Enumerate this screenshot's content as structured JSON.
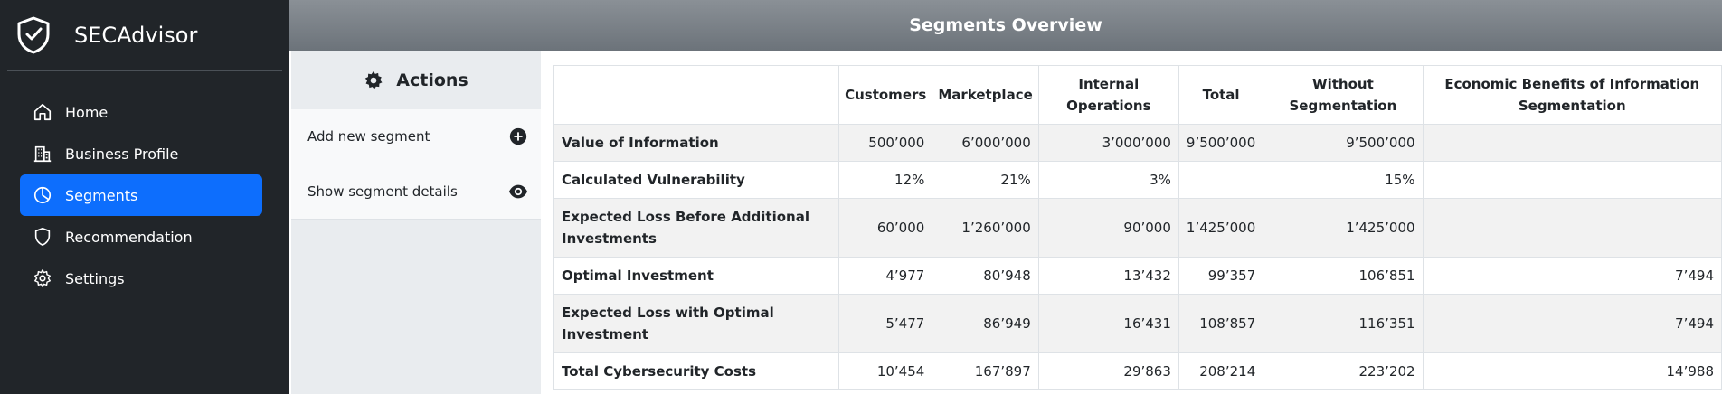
{
  "app": {
    "name": "SECAdvisor"
  },
  "nav": {
    "items": [
      {
        "label": "Home",
        "icon": "home-icon",
        "active": false
      },
      {
        "label": "Business Profile",
        "icon": "building-icon",
        "active": false
      },
      {
        "label": "Segments",
        "icon": "pie-chart-icon",
        "active": true
      },
      {
        "label": "Recommendation",
        "icon": "shield-icon",
        "active": false
      },
      {
        "label": "Settings",
        "icon": "gear-icon",
        "active": false
      }
    ]
  },
  "header": {
    "title": "Segments Overview"
  },
  "actions": {
    "title": "Actions",
    "items": [
      {
        "label": "Add new segment",
        "icon": "plus-circle-icon"
      },
      {
        "label": "Show segment details",
        "icon": "eye-icon"
      }
    ]
  },
  "table": {
    "headers": [
      "",
      "Customers",
      "Marketplace",
      "Internal Operations",
      "Total",
      "Without Segmentation",
      "Economic Benefits of Information Segmentation"
    ],
    "rows": [
      {
        "label": "Value of Information",
        "cells": [
          "500’000",
          "6’000’000",
          "3’000’000",
          "9’500’000",
          "9’500’000",
          ""
        ]
      },
      {
        "label": "Calculated Vulnerability",
        "cells": [
          "12%",
          "21%",
          "3%",
          "",
          "15%",
          ""
        ]
      },
      {
        "label": "Expected Loss Before Additional Investments",
        "cells": [
          "60’000",
          "1’260’000",
          "90’000",
          "1’425’000",
          "1’425’000",
          ""
        ]
      },
      {
        "label": "Optimal Investment",
        "cells": [
          "4’977",
          "80’948",
          "13’432",
          "99’357",
          "106’851",
          "7’494"
        ]
      },
      {
        "label": "Expected Loss with Optimal Investment",
        "cells": [
          "5’477",
          "86’949",
          "16’431",
          "108’857",
          "116’351",
          "7’494"
        ]
      },
      {
        "label": "Total Cybersecurity Costs",
        "cells": [
          "10’454",
          "167’897",
          "29’863",
          "208’214",
          "223’202",
          "14’988"
        ]
      }
    ]
  }
}
